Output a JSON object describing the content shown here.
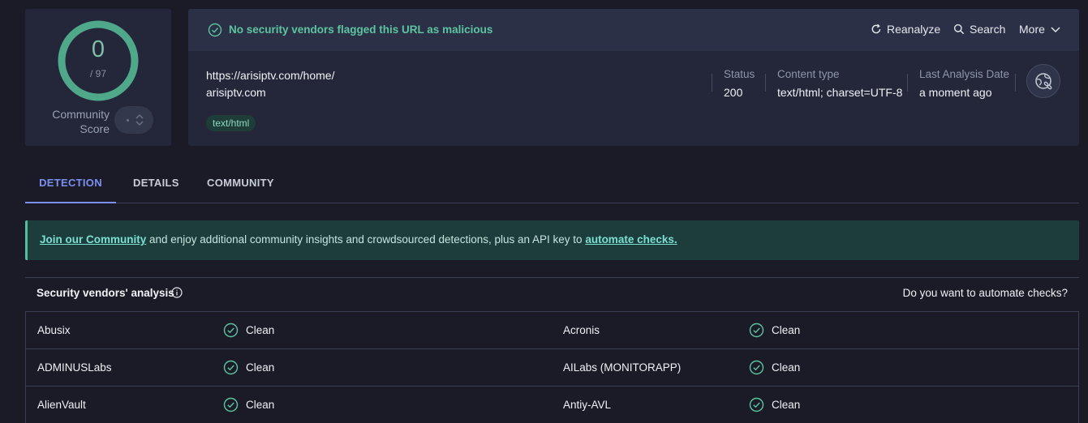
{
  "score": {
    "value": "0",
    "total": "/ 97",
    "community_label": "Community Score"
  },
  "banner_status": {
    "message": "No security vendors flagged this URL as malicious"
  },
  "actions": {
    "reanalyze": "Reanalyze",
    "search": "Search",
    "more": "More"
  },
  "url": {
    "full": "https://arisiptv.com/home/",
    "domain": "arisiptv.com",
    "tag": "text/html"
  },
  "meta": {
    "status_label": "Status",
    "status_value": "200",
    "ctype_label": "Content type",
    "ctype_value": "text/html; charset=UTF-8",
    "date_label": "Last Analysis Date",
    "date_value": "a moment ago"
  },
  "tabs": [
    "DETECTION",
    "DETAILS",
    "COMMUNITY"
  ],
  "community_banner": {
    "join_link": "Join our Community",
    "text": " and enjoy additional community insights and crowdsourced detections, plus an API key to ",
    "automate_link": "automate checks."
  },
  "vendors": {
    "title": "Security vendors' analysis",
    "automate_question": "Do you want to automate checks?",
    "rows": [
      {
        "left_name": "Abusix",
        "left_result": "Clean",
        "right_name": "Acronis",
        "right_result": "Clean"
      },
      {
        "left_name": "ADMINUSLabs",
        "left_result": "Clean",
        "right_name": "AILabs (MONITORAPP)",
        "right_result": "Clean"
      },
      {
        "left_name": "AlienVault",
        "left_result": "Clean",
        "right_name": "Antiy-AVL",
        "right_result": "Clean"
      }
    ]
  },
  "colors": {
    "accent": "#7b8ff0",
    "clean": "#5cc4a0",
    "ring": "#4fa88a",
    "background": "#1b1b28"
  }
}
